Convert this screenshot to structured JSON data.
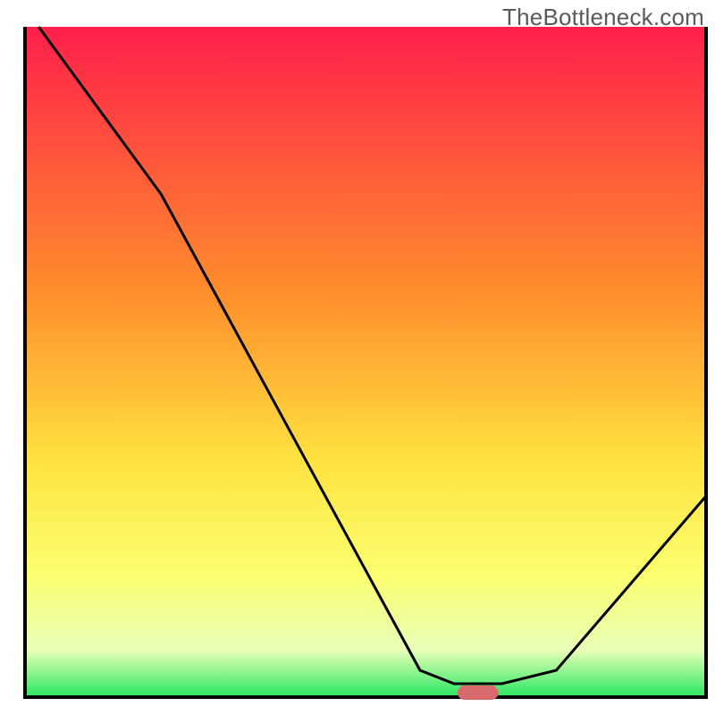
{
  "watermark": "TheBottleneck.com",
  "chart_data": {
    "type": "line",
    "title": "",
    "xlabel": "",
    "ylabel": "",
    "xlim": [
      0,
      100
    ],
    "ylim": [
      0,
      100
    ],
    "x": [
      2,
      20,
      58,
      63,
      70,
      78,
      100
    ],
    "values": [
      100,
      75,
      4,
      2,
      2,
      4,
      30
    ],
    "optimum_marker": {
      "x": 66.5,
      "width": 6
    },
    "gradient_stops": [
      {
        "offset": 0,
        "color": "#ff1f4b"
      },
      {
        "offset": 40,
        "color": "#ff8f2c"
      },
      {
        "offset": 65,
        "color": "#ffe341"
      },
      {
        "offset": 82,
        "color": "#fbff70"
      },
      {
        "offset": 93,
        "color": "#e8ffb8"
      },
      {
        "offset": 100,
        "color": "#27e860"
      }
    ],
    "axis_color": "#000000",
    "curve_color": "#000000",
    "marker_color": "#d86a6d"
  }
}
